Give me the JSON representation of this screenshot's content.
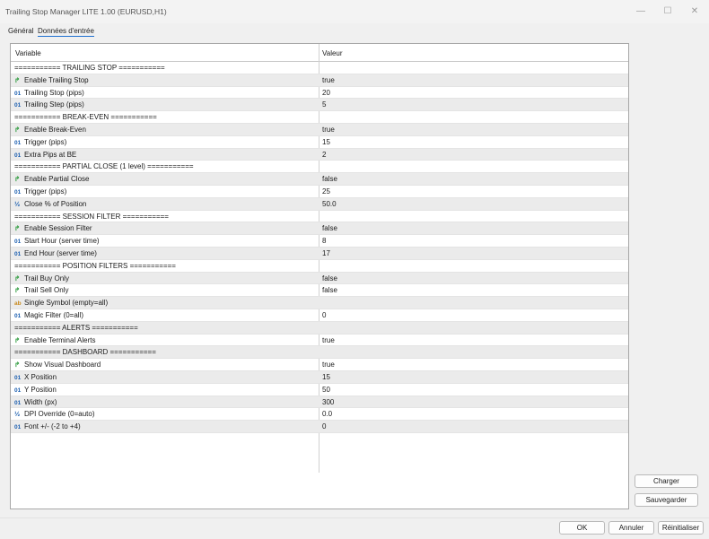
{
  "window": {
    "title": "Trailing Stop Manager LITE 1.00 (EURUSD,H1)"
  },
  "tabs": [
    {
      "label": "Général",
      "active": false
    },
    {
      "label": "Données d'entrée",
      "active": true
    }
  ],
  "grid": {
    "col_variable": "Variable",
    "col_value": "Valeur",
    "rows": [
      {
        "icon": "",
        "variable": "=========== TRAILING STOP ===========",
        "value": ""
      },
      {
        "icon": "bool",
        "variable": "Enable Trailing Stop",
        "value": "true"
      },
      {
        "icon": "int",
        "variable": "Trailing Stop (pips)",
        "value": "20"
      },
      {
        "icon": "int",
        "variable": "Trailing Step (pips)",
        "value": "5"
      },
      {
        "icon": "",
        "variable": "=========== BREAK-EVEN ===========",
        "value": ""
      },
      {
        "icon": "bool",
        "variable": "Enable Break-Even",
        "value": "true"
      },
      {
        "icon": "int",
        "variable": "Trigger (pips)",
        "value": "15"
      },
      {
        "icon": "int",
        "variable": "Extra Pips at BE",
        "value": "2"
      },
      {
        "icon": "",
        "variable": "=========== PARTIAL CLOSE (1 level) ===========",
        "value": ""
      },
      {
        "icon": "bool",
        "variable": "Enable Partial Close",
        "value": "false"
      },
      {
        "icon": "int",
        "variable": "Trigger (pips)",
        "value": "25"
      },
      {
        "icon": "dbl",
        "variable": "Close % of Position",
        "value": "50.0"
      },
      {
        "icon": "",
        "variable": "=========== SESSION FILTER ===========",
        "value": ""
      },
      {
        "icon": "bool",
        "variable": "Enable Session Filter",
        "value": "false"
      },
      {
        "icon": "int",
        "variable": "Start Hour (server time)",
        "value": "8"
      },
      {
        "icon": "int",
        "variable": "End Hour (server time)",
        "value": "17"
      },
      {
        "icon": "",
        "variable": "=========== POSITION FILTERS ===========",
        "value": ""
      },
      {
        "icon": "bool",
        "variable": "Trail Buy Only",
        "value": "false"
      },
      {
        "icon": "bool",
        "variable": "Trail Sell Only",
        "value": "false"
      },
      {
        "icon": "str",
        "variable": "Single Symbol (empty=all)",
        "value": ""
      },
      {
        "icon": "int",
        "variable": "Magic Filter (0=all)",
        "value": "0"
      },
      {
        "icon": "",
        "variable": "=========== ALERTS ===========",
        "value": ""
      },
      {
        "icon": "bool",
        "variable": "Enable Terminal Alerts",
        "value": "true"
      },
      {
        "icon": "",
        "variable": "=========== DASHBOARD ===========",
        "value": ""
      },
      {
        "icon": "bool",
        "variable": "Show Visual Dashboard",
        "value": "true"
      },
      {
        "icon": "int",
        "variable": "X Position",
        "value": "15"
      },
      {
        "icon": "int",
        "variable": "Y Position",
        "value": "50"
      },
      {
        "icon": "int",
        "variable": "Width (px)",
        "value": "300"
      },
      {
        "icon": "dbl",
        "variable": "DPI Override (0=auto)",
        "value": "0.0"
      },
      {
        "icon": "int",
        "variable": "Font +/- (-2 to +4)",
        "value": "0"
      }
    ]
  },
  "icons": {
    "int": "01",
    "bool": "↱",
    "str": "ab",
    "dbl": "½"
  },
  "side_buttons": {
    "load": "Charger",
    "save": "Sauvegarder"
  },
  "bottom_buttons": {
    "ok": "OK",
    "cancel": "Annuler",
    "reset": "Réinitialiser"
  }
}
